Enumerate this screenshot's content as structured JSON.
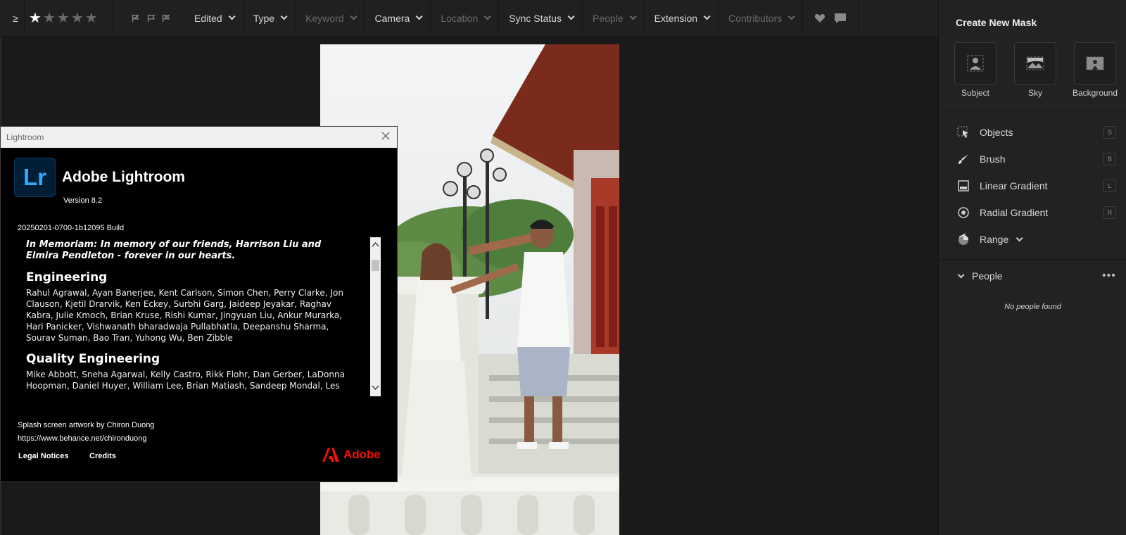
{
  "filter_bar": {
    "rating_operator": "≥",
    "stars_total": 5,
    "stars_selected": 1,
    "dropdowns": [
      {
        "label": "Edited",
        "enabled": true
      },
      {
        "label": "Type",
        "enabled": true
      },
      {
        "label": "Keyword",
        "enabled": false
      },
      {
        "label": "Camera",
        "enabled": true
      },
      {
        "label": "Location",
        "enabled": false
      },
      {
        "label": "Sync Status",
        "enabled": true
      },
      {
        "label": "People",
        "enabled": false
      },
      {
        "label": "Extension",
        "enabled": true
      },
      {
        "label": "Contributors",
        "enabled": false
      }
    ]
  },
  "mask_panel": {
    "title": "Create New Mask",
    "quick_masks": [
      {
        "label": "Subject",
        "icon": "subject-icon"
      },
      {
        "label": "Sky",
        "icon": "sky-icon"
      },
      {
        "label": "Background",
        "icon": "background-icon"
      }
    ],
    "tools": [
      {
        "label": "Objects",
        "shortcut": "S",
        "icon": "objects-icon"
      },
      {
        "label": "Brush",
        "shortcut": "B",
        "icon": "brush-icon"
      },
      {
        "label": "Linear Gradient",
        "shortcut": "L",
        "icon": "linear-gradient-icon"
      },
      {
        "label": "Radial Gradient",
        "shortcut": "R",
        "icon": "radial-gradient-icon"
      },
      {
        "label": "Range",
        "shortcut": "",
        "icon": "range-icon"
      }
    ],
    "people_section": {
      "title": "People",
      "empty_text": "No people found"
    }
  },
  "about_dialog": {
    "window_title": "Lightroom",
    "logo_text": "Lr",
    "app_name": "Adobe Lightroom",
    "version": "Version 8.2",
    "build": "20250201-0700-1b12095 Build",
    "memoriam": "In Memoriam: In memory of our friends, Harrison Liu and Elmira Pendleton - forever in our hearts.",
    "sections": [
      {
        "heading": "Engineering",
        "names": "Rahul Agrawal, Ayan Banerjee, Kent Carlson, Simon Chen, Perry Clarke, Jon Clauson, Kjetil Drarvik, Ken Eckey, Surbhi Garg, Jaideep Jeyakar, Raghav Kabra, Julie Kmoch, Brian Kruse, Rishi Kumar, Jingyuan Liu, Ankur Murarka, Hari Panicker, Vishwanath bharadwaja Pullabhatla, Deepanshu Sharma, Sourav Suman, Bao Tran, Yuhong Wu, Ben Zibble"
      },
      {
        "heading": "Quality Engineering",
        "names": "Mike Abbott, Sneha Agarwal, Kelly Castro, Rikk Flohr, Dan Gerber, LaDonna Hoopman, Daniel Huyer, William Lee, Brian Matiash, Sandeep Mondal, Les"
      }
    ],
    "splash_credit": "Splash screen artwork by Chiron Duong",
    "splash_url": "https://www.behance.net/chironduong",
    "legal_link": "Legal Notices",
    "credits_link": "Credits",
    "brand": "Adobe"
  },
  "colors": {
    "lr_blue": "#31a8ff",
    "lr_bg": "#001e36",
    "adobe_red": "#fa0f00"
  }
}
